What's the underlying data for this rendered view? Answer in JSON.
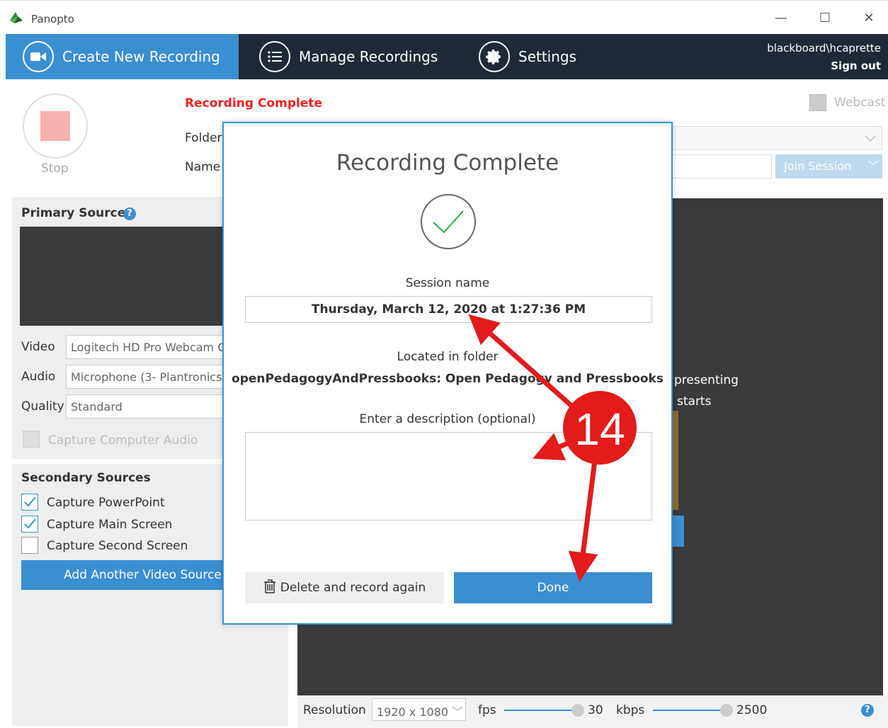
{
  "window": {
    "app_title": "Panopto"
  },
  "nav": {
    "create": "Create New Recording",
    "manage": "Manage Recordings",
    "settings": "Settings",
    "user": "blackboard\\hcaprette",
    "signout": "Sign out"
  },
  "top": {
    "stop": "Stop",
    "status": "Recording Complete",
    "folder_label": "Folder",
    "name_label": "Name",
    "webcast": "Webcast",
    "join": "Join Session"
  },
  "primary": {
    "title": "Primary Sources",
    "video_label": "Video",
    "video_value": "Logitech HD Pro Webcam C",
    "audio_label": "Audio",
    "audio_value": "Microphone (3- Plantronics",
    "quality_label": "Quality",
    "quality_value": "Standard",
    "capture_audio": "Capture Computer Audio"
  },
  "secondary": {
    "title": "Secondary Sources",
    "items": [
      {
        "label": "Capture PowerPoint",
        "checked": true
      },
      {
        "label": "Capture Main Screen",
        "checked": true
      },
      {
        "label": "Capture Second Screen",
        "checked": false
      }
    ],
    "add_button": "Add Another Video Source"
  },
  "preview_text": {
    "line1": "presenting",
    "line2": "starts"
  },
  "bottom": {
    "resolution_label": "Resolution",
    "resolution_value": "1920 x 1080",
    "fps_label": "fps",
    "fps_value": "30",
    "kbps_label": "kbps",
    "kbps_value": "2500"
  },
  "modal": {
    "title": "Recording Complete",
    "session_label": "Session name",
    "session_value": "Thursday, March 12, 2020 at 1:27:36 PM",
    "folder_label": "Located in folder",
    "folder_value": "openPedagogyAndPressbooks: Open Pedagogy and Pressbooks",
    "desc_label": "Enter a description (optional)",
    "delete_button": "Delete and record again",
    "done_button": "Done"
  },
  "annotation": {
    "step": "14",
    "color": "#e21b1b"
  }
}
